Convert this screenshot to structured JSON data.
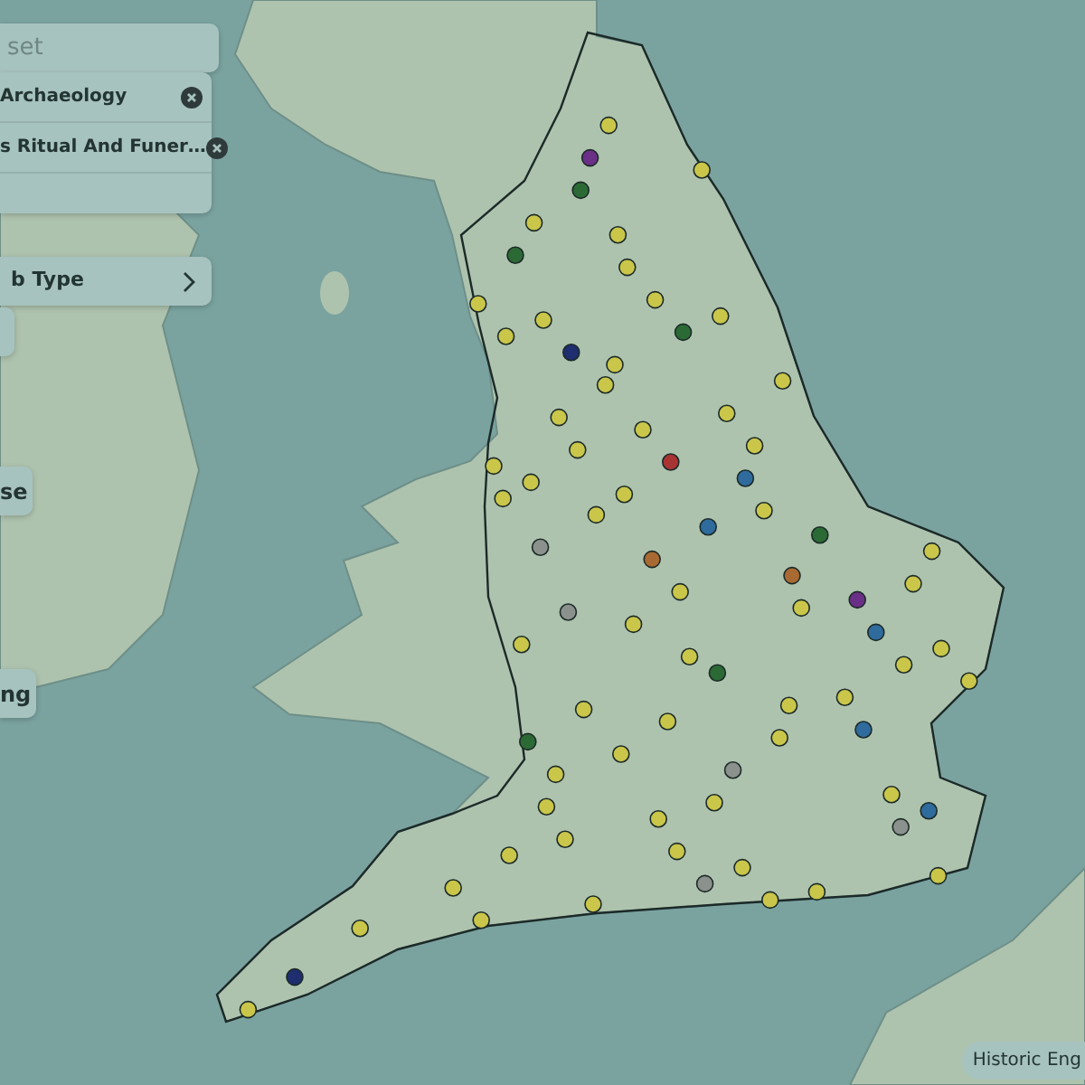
{
  "filters": {
    "search": {
      "placeholder": "set"
    },
    "chips": [
      {
        "label": "Archaeology"
      },
      {
        "label": "s Ritual And Funer…"
      }
    ],
    "sub_type": {
      "label": "b Type"
    },
    "buttons": [
      {
        "kind": "blank"
      },
      {
        "kind": "text",
        "label": "se"
      },
      {
        "kind": "text",
        "label": "ng"
      }
    ]
  },
  "map": {
    "markers": [
      {
        "color": "#c9c64a"
      },
      {
        "color": "#c9c64a"
      },
      {
        "color": "#2c6a35"
      },
      {
        "color": "#c9c64a"
      },
      {
        "color": "#2f6b9c"
      },
      {
        "color": "#c9c64a"
      },
      {
        "color": "#c9c64a"
      },
      {
        "color": "#8b918c"
      },
      {
        "color": "#c9c64a"
      },
      {
        "color": "#c9c64a"
      },
      {
        "color": "#c9c64a"
      },
      {
        "color": "#6a2f86"
      },
      {
        "color": "#c9c64a"
      },
      {
        "color": "#c9c64a"
      },
      {
        "color": "#2c6a35"
      },
      {
        "color": "#c9c64a"
      },
      {
        "color": "#c9c64a"
      },
      {
        "color": "#2f6b9c"
      },
      {
        "color": "#c9c64a"
      },
      {
        "color": "#a86a32"
      },
      {
        "color": "#c9c64a"
      },
      {
        "color": "#c9c64a"
      },
      {
        "color": "#c9c64a"
      },
      {
        "color": "#8b918c"
      },
      {
        "color": "#c9c64a"
      },
      {
        "color": "#c9c64a"
      },
      {
        "color": "#2c6a35"
      },
      {
        "color": "#c9c64a"
      },
      {
        "color": "#c9c64a"
      },
      {
        "color": "#a83434"
      },
      {
        "color": "#c9c64a"
      },
      {
        "color": "#1f2e6e"
      },
      {
        "color": "#c9c64a"
      },
      {
        "color": "#c9c64a"
      },
      {
        "color": "#c9c64a"
      },
      {
        "color": "#2f6b9c"
      },
      {
        "color": "#c9c64a"
      },
      {
        "color": "#c9c64a"
      },
      {
        "color": "#c9c64a"
      },
      {
        "color": "#8b918c"
      },
      {
        "color": "#c9c64a"
      },
      {
        "color": "#c9c64a"
      },
      {
        "color": "#2c6a35"
      },
      {
        "color": "#c9c64a"
      },
      {
        "color": "#c9c64a"
      },
      {
        "color": "#c9c64a"
      },
      {
        "color": "#6a2f86"
      },
      {
        "color": "#c9c64a"
      },
      {
        "color": "#c9c64a"
      },
      {
        "color": "#2f6b9c"
      },
      {
        "color": "#c9c64a"
      },
      {
        "color": "#c9c64a"
      },
      {
        "color": "#c9c64a"
      },
      {
        "color": "#c9c64a"
      },
      {
        "color": "#2c6a35"
      },
      {
        "color": "#c9c64a"
      },
      {
        "color": "#8b918c"
      },
      {
        "color": "#c9c64a"
      },
      {
        "color": "#c9c64a"
      },
      {
        "color": "#c9c64a"
      },
      {
        "color": "#c9c64a"
      },
      {
        "color": "#1f2e6e"
      },
      {
        "color": "#c9c64a"
      },
      {
        "color": "#c9c64a"
      },
      {
        "color": "#a86a32"
      },
      {
        "color": "#c9c64a"
      },
      {
        "color": "#c9c64a"
      },
      {
        "color": "#2f6b9c"
      },
      {
        "color": "#c9c64a"
      },
      {
        "color": "#c9c64a"
      },
      {
        "color": "#c9c64a"
      },
      {
        "color": "#2c6a35"
      },
      {
        "color": "#c9c64a"
      },
      {
        "color": "#c9c64a"
      },
      {
        "color": "#c9c64a"
      },
      {
        "color": "#8b918c"
      },
      {
        "color": "#c9c64a"
      },
      {
        "color": "#c9c64a"
      },
      {
        "color": "#c9c64a"
      },
      {
        "color": "#c9c64a"
      }
    ]
  },
  "attribution": "Historic Eng"
}
